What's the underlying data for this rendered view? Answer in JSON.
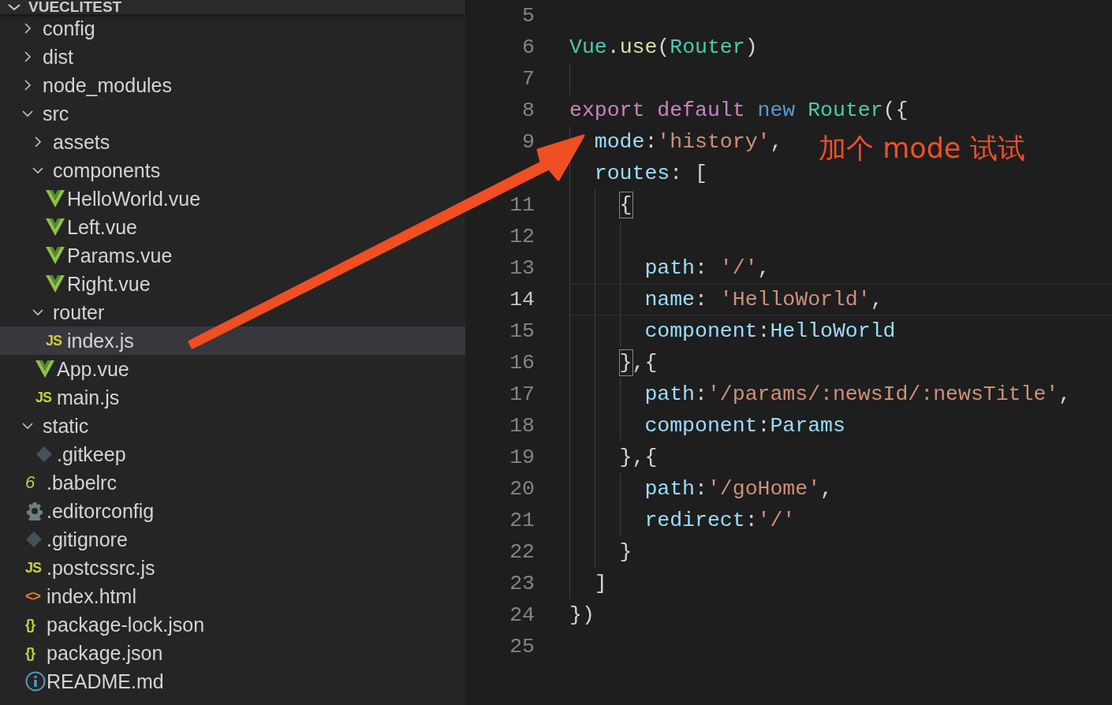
{
  "explorer": {
    "title": "VUECLITEST",
    "expanded": true,
    "items": [
      {
        "name": "config",
        "kind": "folder",
        "expanded": false,
        "selected": false
      },
      {
        "name": "dist",
        "kind": "folder",
        "expanded": false,
        "selected": false
      },
      {
        "name": "node_modules",
        "kind": "folder",
        "expanded": false,
        "selected": false
      },
      {
        "name": "src",
        "kind": "folder",
        "expanded": true,
        "selected": false,
        "children": [
          {
            "name": "assets",
            "kind": "folder",
            "expanded": false,
            "selected": false
          },
          {
            "name": "components",
            "kind": "folder",
            "expanded": true,
            "selected": false,
            "children": [
              {
                "name": "HelloWorld.vue",
                "kind": "vue",
                "selected": false
              },
              {
                "name": "Left.vue",
                "kind": "vue",
                "selected": false
              },
              {
                "name": "Params.vue",
                "kind": "vue",
                "selected": false
              },
              {
                "name": "Right.vue",
                "kind": "vue",
                "selected": false
              }
            ]
          },
          {
            "name": "router",
            "kind": "folder",
            "expanded": true,
            "selected": false,
            "children": [
              {
                "name": "index.js",
                "kind": "js",
                "glyph": "JS",
                "selected": true
              }
            ]
          },
          {
            "name": "App.vue",
            "kind": "vue",
            "selected": false
          },
          {
            "name": "main.js",
            "kind": "js",
            "glyph": "JS",
            "selected": false
          }
        ]
      },
      {
        "name": "static",
        "kind": "folder",
        "expanded": true,
        "selected": false,
        "children": [
          {
            "name": ".gitkeep",
            "kind": "git",
            "selected": false
          }
        ]
      },
      {
        "name": ".babelrc",
        "kind": "babel",
        "glyph": "6",
        "selected": false
      },
      {
        "name": ".editorconfig",
        "kind": "gear",
        "selected": false
      },
      {
        "name": ".gitignore",
        "kind": "git",
        "selected": false
      },
      {
        "name": ".postcssrc.js",
        "kind": "js",
        "glyph": "JS",
        "selected": false
      },
      {
        "name": "index.html",
        "kind": "html",
        "glyph": "<>",
        "selected": false
      },
      {
        "name": "package-lock.json",
        "kind": "json",
        "glyph": "{}",
        "selected": false
      },
      {
        "name": "package.json",
        "kind": "json",
        "glyph": "{}",
        "selected": false
      },
      {
        "name": "README.md",
        "kind": "info",
        "selected": false
      }
    ]
  },
  "editor": {
    "lines": [
      {
        "number": "5",
        "current": false
      },
      {
        "number": "6",
        "current": false,
        "tokens": [
          {
            "kind": "type",
            "text": "Vue"
          },
          {
            "kind": "punct",
            "text": "."
          },
          {
            "kind": "function",
            "text": "use"
          },
          {
            "kind": "punct",
            "text": "("
          },
          {
            "kind": "type",
            "text": "Router"
          },
          {
            "kind": "punct",
            "text": ")"
          }
        ]
      },
      {
        "number": "7",
        "current": false
      },
      {
        "number": "8",
        "current": false,
        "tokens": [
          {
            "kind": "keyword",
            "text": "export default "
          },
          {
            "kind": "storage",
            "text": "new "
          },
          {
            "kind": "type",
            "text": "Router"
          },
          {
            "kind": "punct",
            "text": "({"
          }
        ]
      },
      {
        "number": "9",
        "current": false,
        "tokens": [
          {
            "kind": "property",
            "text": "  mode"
          },
          {
            "kind": "punct",
            "text": ":"
          },
          {
            "kind": "string",
            "text": "'history'"
          },
          {
            "kind": "punct",
            "text": ","
          }
        ]
      },
      {
        "current": false,
        "tokens": [
          {
            "kind": "property",
            "text": "  routes"
          },
          {
            "kind": "punct",
            "text": ": ["
          }
        ]
      },
      {
        "number": "11",
        "current": false,
        "tokens": [
          {
            "kind": "bracket-match",
            "text": "    {"
          }
        ]
      },
      {
        "number": "12",
        "current": false
      },
      {
        "number": "13",
        "current": false,
        "tokens": [
          {
            "kind": "property",
            "text": "      path"
          },
          {
            "kind": "punct",
            "text": ": "
          },
          {
            "kind": "string",
            "text": "'/'"
          },
          {
            "kind": "punct",
            "text": ","
          }
        ]
      },
      {
        "number": "14",
        "current": true,
        "tokens": [
          {
            "kind": "property",
            "text": "      name"
          },
          {
            "kind": "punct",
            "text": ": "
          },
          {
            "kind": "string",
            "text": "'HelloWorld'"
          },
          {
            "kind": "punct",
            "text": ","
          }
        ]
      },
      {
        "number": "15",
        "current": false,
        "tokens": [
          {
            "kind": "property",
            "text": "      component"
          },
          {
            "kind": "punct",
            "text": ":"
          },
          {
            "kind": "property",
            "text": "HelloWorld"
          }
        ]
      },
      {
        "number": "16",
        "current": false,
        "tokens": [
          {
            "kind": "bracket-match",
            "text": "    }"
          },
          {
            "kind": "punct",
            "text": ",{"
          }
        ]
      },
      {
        "number": "17",
        "current": false,
        "tokens": [
          {
            "kind": "property",
            "text": "      path"
          },
          {
            "kind": "punct",
            "text": ":"
          },
          {
            "kind": "string",
            "text": "'/params/:newsId/:newsTitle'"
          },
          {
            "kind": "punct",
            "text": ","
          }
        ]
      },
      {
        "number": "18",
        "current": false,
        "tokens": [
          {
            "kind": "property",
            "text": "      component"
          },
          {
            "kind": "punct",
            "text": ":"
          },
          {
            "kind": "property",
            "text": "Params"
          }
        ]
      },
      {
        "number": "19",
        "current": false,
        "tokens": [
          {
            "kind": "punct",
            "text": "    },{"
          }
        ]
      },
      {
        "number": "20",
        "current": false,
        "tokens": [
          {
            "kind": "property",
            "text": "      path"
          },
          {
            "kind": "punct",
            "text": ":"
          },
          {
            "kind": "string",
            "text": "'/goHome'"
          },
          {
            "kind": "punct",
            "text": ","
          }
        ]
      },
      {
        "number": "21",
        "current": false,
        "tokens": [
          {
            "kind": "property",
            "text": "      redirect"
          },
          {
            "kind": "punct",
            "text": ":"
          },
          {
            "kind": "string",
            "text": "'/'"
          }
        ]
      },
      {
        "number": "22",
        "current": false,
        "tokens": [
          {
            "kind": "punct",
            "text": "    }"
          }
        ]
      },
      {
        "number": "23",
        "current": false,
        "tokens": [
          {
            "kind": "punct",
            "text": "  ]"
          }
        ]
      },
      {
        "number": "24",
        "current": false,
        "tokens": [
          {
            "kind": "punct",
            "text": "})"
          }
        ]
      },
      {
        "number": "25",
        "current": false
      }
    ]
  },
  "annotation": {
    "text": "加个 mode 试试"
  }
}
